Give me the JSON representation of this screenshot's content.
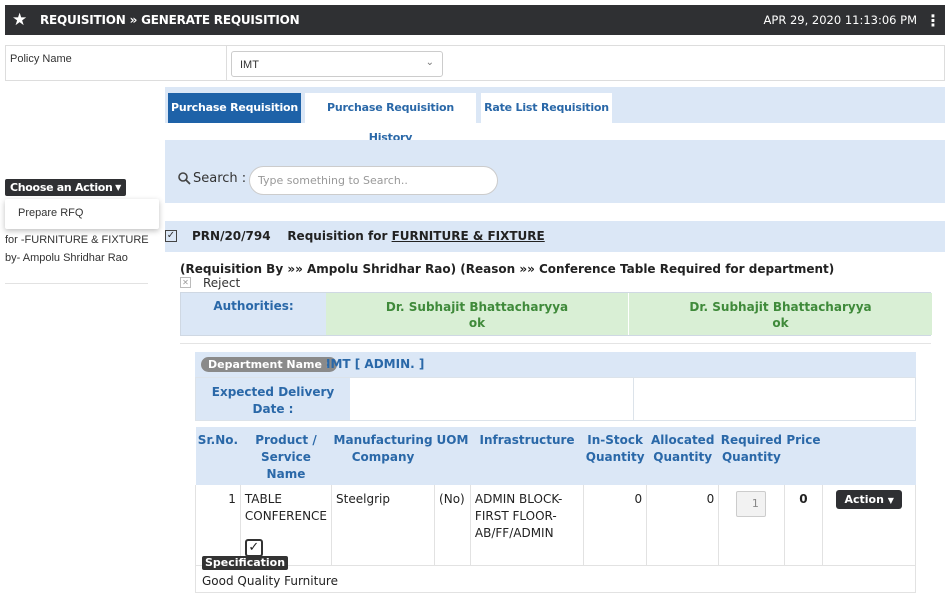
{
  "header": {
    "breadcrumb": "REQUISITION » GENERATE REQUISITION",
    "datetime": "APR 29, 2020  11:13:06 PM"
  },
  "policy": {
    "label": "Policy Name",
    "value": "IMT"
  },
  "tabs": [
    {
      "label": "Purchase Requisition",
      "active": true
    },
    {
      "label": "Purchase Requisition History",
      "active": false
    },
    {
      "label": "Rate List Requisition",
      "active": false
    }
  ],
  "sidebar": {
    "action_label": "Choose an Action",
    "menu_item": "Prepare RFQ",
    "for_line": "for -FURNITURE & FIXTURE",
    "by_line": "by-  Ampolu Shridhar Rao"
  },
  "search": {
    "label": "Search :",
    "placeholder": "Type something to Search.."
  },
  "requisition": {
    "prn": "PRN/20/794",
    "title_prefix": "Requisition for",
    "title_target": "FURNITURE & FIXTURE",
    "info": "(Requisition By »» Ampolu Shridhar Rao)  (Reason »» Conference Table Required for department)",
    "reject_label": "Reject",
    "authorities_label": "Authorities:",
    "authorities": [
      {
        "name": "Dr. Subhajit Bhattacharyya",
        "status": "ok"
      },
      {
        "name": "Dr. Subhajit Bhattacharyya",
        "status": "ok"
      }
    ],
    "department_label": "Department Name :",
    "department_value": "IMT [ ADMIN. ]",
    "edd_label": "Expected Delivery Date :",
    "table_headers": [
      "Sr.No.",
      "Product / Service Name",
      "Manufacturing Company",
      "UOM",
      "Infrastructure",
      "In-Stock Quantity",
      "Allocated Quantity",
      "Required Quantity",
      "Price"
    ],
    "item": {
      "sr_no": "1",
      "product": "TABLE CONFERENCE",
      "company": "Steelgrip",
      "uom": "(No)",
      "infrastructure": "ADMIN BLOCK-FIRST FLOOR-AB/FF/ADMIN",
      "in_stock": "0",
      "allocated": "0",
      "required": "1",
      "price": "0",
      "action_label": "Action"
    },
    "specification_label": "Specification",
    "specification_value": "Good Quality Furniture"
  }
}
